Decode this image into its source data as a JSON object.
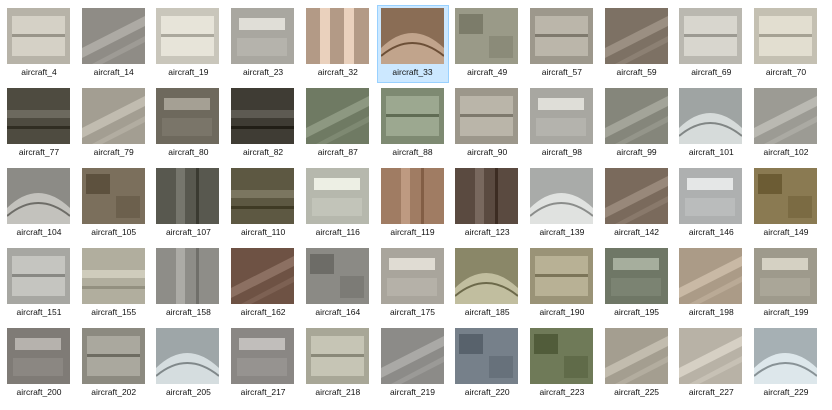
{
  "window": {
    "view": "large-icons",
    "selected_item": "aircraft_33"
  },
  "files": [
    {
      "name": "aircraft_4",
      "tone": "#b7b3a8",
      "feature": "apron"
    },
    {
      "name": "aircraft_14",
      "tone": "#8f8c86",
      "feature": "runway-diag"
    },
    {
      "name": "aircraft_19",
      "tone": "#c9c6bb",
      "feature": "apron"
    },
    {
      "name": "aircraft_23",
      "tone": "#a9a7a0",
      "feature": "terminal"
    },
    {
      "name": "aircraft_32",
      "tone": "#b39a86",
      "feature": "terminal-vertical"
    },
    {
      "name": "aircraft_33",
      "tone": "#8a6d55",
      "feature": "terminal-curve"
    },
    {
      "name": "aircraft_49",
      "tone": "#9a9a88",
      "feature": "apron-dark"
    },
    {
      "name": "aircraft_57",
      "tone": "#9d988c",
      "feature": "apron"
    },
    {
      "name": "aircraft_59",
      "tone": "#7d7164",
      "feature": "runway-diag"
    },
    {
      "name": "aircraft_69",
      "tone": "#bab8b0",
      "feature": "apron"
    },
    {
      "name": "aircraft_70",
      "tone": "#c4c0b2",
      "feature": "apron"
    },
    {
      "name": "aircraft_77",
      "tone": "#4e4b40",
      "feature": "runway-horiz"
    },
    {
      "name": "aircraft_79",
      "tone": "#a39e92",
      "feature": "runway-diag"
    },
    {
      "name": "aircraft_80",
      "tone": "#6e695d",
      "feature": "terminal"
    },
    {
      "name": "aircraft_82",
      "tone": "#3f3c34",
      "feature": "runway-horiz"
    },
    {
      "name": "aircraft_87",
      "tone": "#6f7a63",
      "feature": "runway-diag"
    },
    {
      "name": "aircraft_88",
      "tone": "#7e8a72",
      "feature": "apron"
    },
    {
      "name": "aircraft_90",
      "tone": "#9c978b",
      "feature": "apron"
    },
    {
      "name": "aircraft_98",
      "tone": "#a8a7a1",
      "feature": "terminal"
    },
    {
      "name": "aircraft_99",
      "tone": "#85867b",
      "feature": "runway-diag"
    },
    {
      "name": "aircraft_101",
      "tone": "#9fa4a3",
      "feature": "terminal-curve"
    },
    {
      "name": "aircraft_102",
      "tone": "#9c9b94",
      "feature": "runway-diag"
    },
    {
      "name": "aircraft_104",
      "tone": "#8c8b86",
      "feature": "terminal-curve"
    },
    {
      "name": "aircraft_105",
      "tone": "#7b6f5c",
      "feature": "apron-dark"
    },
    {
      "name": "aircraft_107",
      "tone": "#58584f",
      "feature": "runway-vert"
    },
    {
      "name": "aircraft_110",
      "tone": "#5d5842",
      "feature": "runway-horiz"
    },
    {
      "name": "aircraft_116",
      "tone": "#b6b8ad",
      "feature": "terminal"
    },
    {
      "name": "aircraft_119",
      "tone": "#a07c63",
      "feature": "runway-vert"
    },
    {
      "name": "aircraft_123",
      "tone": "#5a4a40",
      "feature": "runway-vert"
    },
    {
      "name": "aircraft_139",
      "tone": "#a9aba9",
      "feature": "terminal-curve"
    },
    {
      "name": "aircraft_142",
      "tone": "#7a6a5c",
      "feature": "runway-diag"
    },
    {
      "name": "aircraft_146",
      "tone": "#aeb0b0",
      "feature": "terminal"
    },
    {
      "name": "aircraft_149",
      "tone": "#8a7a52",
      "feature": "apron-dark"
    },
    {
      "name": "aircraft_151",
      "tone": "#a7a7a2",
      "feature": "apron"
    },
    {
      "name": "aircraft_155",
      "tone": "#b1ae9e",
      "feature": "runway-horiz"
    },
    {
      "name": "aircraft_158",
      "tone": "#8e8d88",
      "feature": "runway-vert"
    },
    {
      "name": "aircraft_162",
      "tone": "#6e5244",
      "feature": "runway-diag"
    },
    {
      "name": "aircraft_164",
      "tone": "#8b8a85",
      "feature": "apron-dark"
    },
    {
      "name": "aircraft_175",
      "tone": "#a9a59c",
      "feature": "terminal"
    },
    {
      "name": "aircraft_185",
      "tone": "#8a8768",
      "feature": "terminal-curve"
    },
    {
      "name": "aircraft_190",
      "tone": "#9a9377",
      "feature": "apron"
    },
    {
      "name": "aircraft_195",
      "tone": "#6f7766",
      "feature": "terminal"
    },
    {
      "name": "aircraft_198",
      "tone": "#ab9b87",
      "feature": "runway-diag"
    },
    {
      "name": "aircraft_199",
      "tone": "#9e9a8c",
      "feature": "terminal"
    },
    {
      "name": "aircraft_200",
      "tone": "#7f7b76",
      "feature": "terminal"
    },
    {
      "name": "aircraft_202",
      "tone": "#8c8a80",
      "feature": "apron"
    },
    {
      "name": "aircraft_205",
      "tone": "#9ea6a8",
      "feature": "terminal-curve"
    },
    {
      "name": "aircraft_217",
      "tone": "#8a8784",
      "feature": "terminal"
    },
    {
      "name": "aircraft_218",
      "tone": "#a8a797",
      "feature": "apron"
    },
    {
      "name": "aircraft_219",
      "tone": "#8c8b88",
      "feature": "runway-diag"
    },
    {
      "name": "aircraft_220",
      "tone": "#76808a",
      "feature": "apron-dark"
    },
    {
      "name": "aircraft_223",
      "tone": "#6f7a58",
      "feature": "apron-dark"
    },
    {
      "name": "aircraft_225",
      "tone": "#a49e90",
      "feature": "runway-diag"
    },
    {
      "name": "aircraft_227",
      "tone": "#b8b2a6",
      "feature": "runway-diag"
    },
    {
      "name": "aircraft_229",
      "tone": "#a6b0b4",
      "feature": "terminal-curve"
    }
  ]
}
